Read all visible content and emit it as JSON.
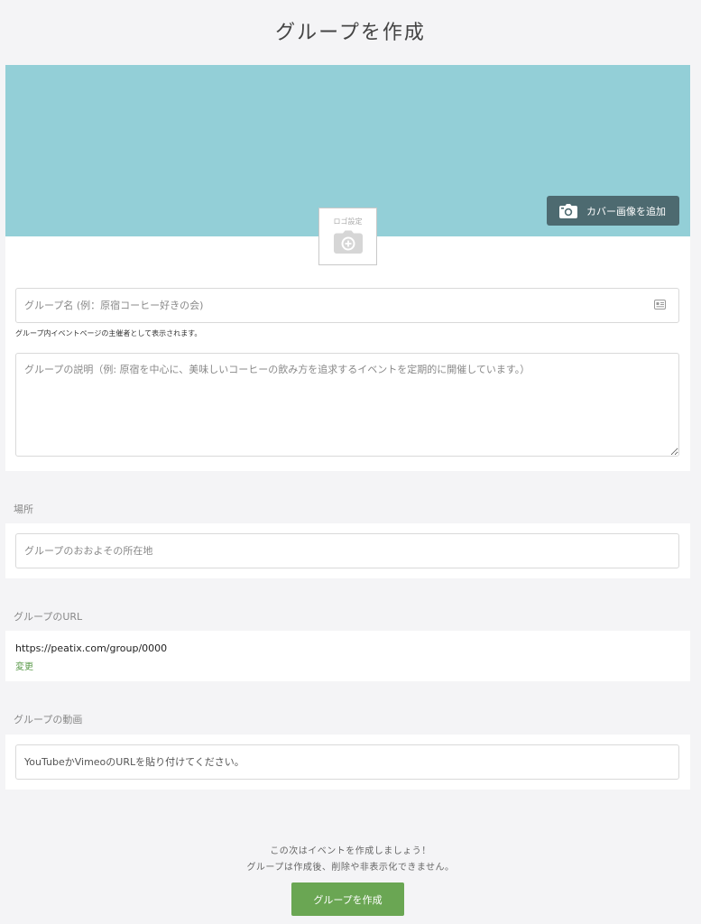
{
  "page": {
    "title": "グループを作成"
  },
  "cover": {
    "add_cover_label": "カバー画像を追加",
    "icon": "camera-icon"
  },
  "logo": {
    "label": "ロゴ設定",
    "icon": "camera-plus-icon"
  },
  "group_name": {
    "placeholder": "グループ名 (例：原宿コーヒー好きの会)",
    "value": "",
    "helper": "グループ内イベントページの主催者として表示されます。",
    "icon": "id-card-icon"
  },
  "description": {
    "placeholder": "グループの説明（例: 原宿を中心に、美味しいコーヒーの飲み方を追求するイベントを定期的に開催しています。）",
    "value": ""
  },
  "location": {
    "section_label": "場所",
    "placeholder": "グループのおおよその所在地",
    "value": ""
  },
  "url": {
    "section_label": "グループのURL",
    "value": "https://peatix.com/group/0000",
    "change_label": "変更"
  },
  "video": {
    "section_label": "グループの動画",
    "placeholder": "YouTubeかVimeoのURLを貼り付けてください。",
    "value": ""
  },
  "footer": {
    "note_line1": "この次はイベントを作成しましょう！",
    "note_line2": "グループは作成後、削除や非表示化できません。",
    "create_label": "グループを作成"
  },
  "colors": {
    "cover_bg": "#93cfd7",
    "cover_button_bg": "#4d6a70",
    "accent_green": "#6aa653",
    "link_green": "#5a9a4a",
    "page_bg": "#f4f4f6"
  }
}
